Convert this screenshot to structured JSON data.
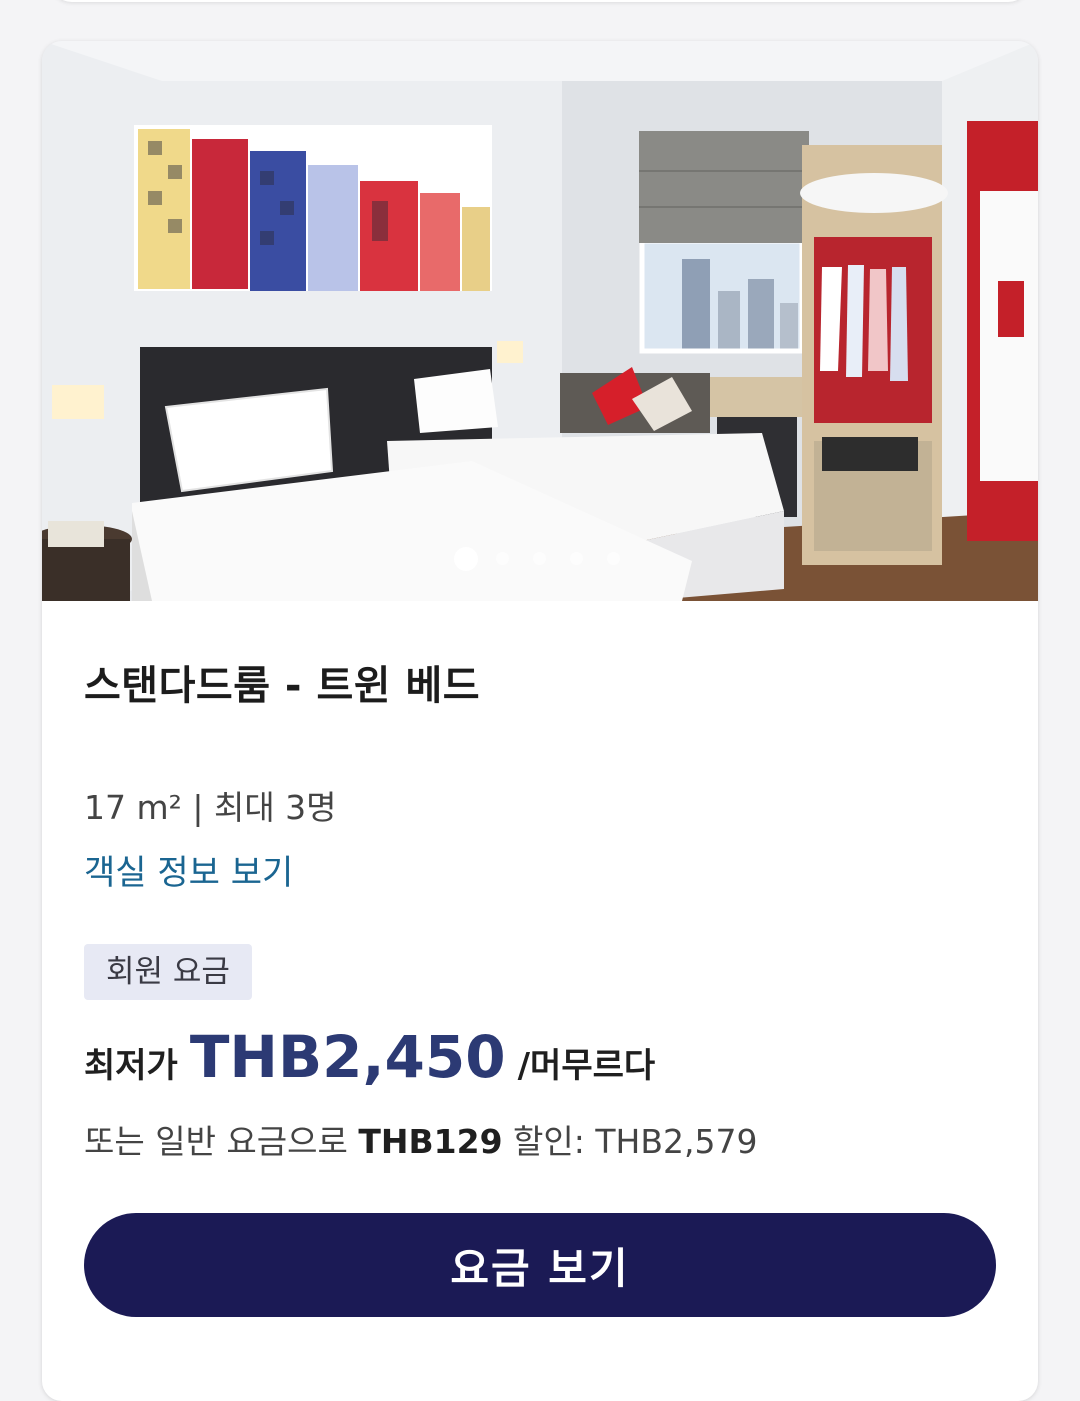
{
  "room": {
    "title": "스탠다드룸 - 트윈 베드",
    "specs": "17 m² | 최대 3명",
    "info_link": "객실 정보 보기",
    "image_count": 5,
    "active_image": 1
  },
  "rate": {
    "badge": "회원 요금",
    "prefix": "최저가",
    "amount": "THB2,450",
    "suffix": "/머무르다",
    "alt_prefix": "또는 일반 요금으로",
    "alt_discount": "THB129",
    "alt_suffix": "할인: THB2,579"
  },
  "actions": {
    "view_rates": "요금 보기"
  },
  "colors": {
    "accent": "#2c3a74",
    "button": "#1b1a55",
    "link": "#1a6591",
    "badge_bg": "#e7e9f4"
  },
  "icons": [
    "carousel-dot-icon"
  ]
}
